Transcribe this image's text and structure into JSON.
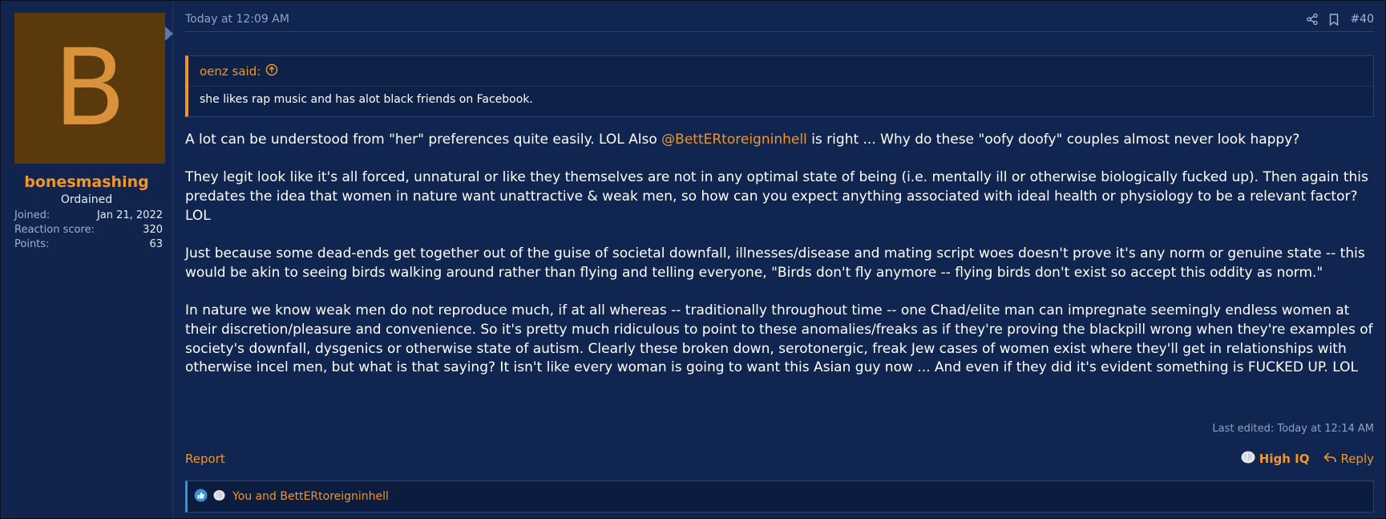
{
  "user": {
    "avatar_letter": "B",
    "name": "bonesmashing",
    "title": "Ordained",
    "stats": [
      {
        "label": "Joined:",
        "value": "Jan 21, 2022"
      },
      {
        "label": "Reaction score:",
        "value": "320"
      },
      {
        "label": "Points:",
        "value": "63"
      }
    ]
  },
  "header": {
    "timestamp": "Today at 12:09 AM",
    "post_number": "#40",
    "icons": [
      "share-icon",
      "bookmark-icon"
    ]
  },
  "quote": {
    "author": "oenz said:",
    "text": "she likes rap music and has alot black friends on Facebook."
  },
  "body": {
    "p1_before": "A lot can be understood from \"her\" preferences quite easily. LOL Also ",
    "p1_mention": "@BettERtoreigninhell",
    "p1_after": " is right ... Why do these \"oofy doofy\" couples almost never look happy?",
    "p2": "They legit look like it's all forced, unnatural or like they themselves are not in any optimal state of being (i.e. mentally ill or otherwise biologically fucked up). Then again this predates the idea that women in nature want unattractive & weak men, so how can you expect anything associated with ideal health or physiology to be a relevant factor? LOL",
    "p3": "Just because some dead-ends get together out of the guise of societal downfall, illnesses/disease and mating script woes doesn't prove it's any norm or genuine state -- this would be akin to seeing birds walking around rather than flying and telling everyone, \"Birds don't fly anymore -- flying birds don't exist so accept this oddity as norm.\"",
    "p4": "In nature we know weak men do not reproduce much, if at all whereas -- traditionally throughout time -- one Chad/elite man can impregnate seemingly endless women at their discretion/pleasure and convenience. So it's pretty much ridiculous to point to these anomalies/freaks as if they're proving the blackpill wrong when they're examples of society's downfall, dysgenics or otherwise state of autism. Clearly these broken down, serotonergic, freak Jew cases of women exist where they'll get in relationships with otherwise incel men, but what is that saying? It isn't like every woman is going to want this Asian guy now ... And even if they did it's evident something is FUCKED UP. LOL"
  },
  "edited": "Last edited: Today at 12:14 AM",
  "actions": {
    "report": "Report",
    "high_iq": "High IQ",
    "reply": "Reply"
  },
  "reactions": {
    "text": "You and BettERtoreigninhell",
    "icons": [
      "like-icon",
      "brain-icon"
    ]
  },
  "colors": {
    "accent": "#f0962a",
    "background": "#102550",
    "avatar_bg": "#5a3a0c"
  }
}
